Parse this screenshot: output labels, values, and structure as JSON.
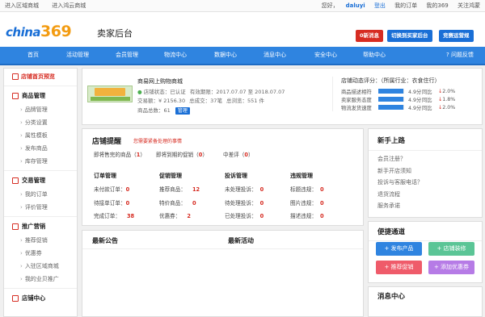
{
  "topbar": {
    "left": [
      "进入区域商城",
      "进入鸿云商城"
    ],
    "greeting": "您好，",
    "username": "daluyi",
    "logout": "登出",
    "right": [
      "我的订单",
      "我的369",
      "关注鸿蒙"
    ]
  },
  "header": {
    "logo_text": "china",
    "logo_number": "369",
    "title": "卖家后台",
    "btn_messages": "0新消息",
    "btn_switch": "切换到买家后台",
    "btn_rules": "竞赛运营规"
  },
  "nav": {
    "items": [
      "首页",
      "活动管理",
      "会员管理",
      "物流中心",
      "数据中心",
      "消息中心",
      "安全中心",
      "帮助中心"
    ],
    "feedback": "问题反馈"
  },
  "sidebar": {
    "home": "店铺首页预览",
    "sections": [
      {
        "title": "商品管理",
        "items": [
          "品牌管理",
          "分类设置",
          "属性模板",
          "发布商品",
          "库存管理"
        ]
      },
      {
        "title": "交易管理",
        "items": [
          "我的订单",
          "评价管理"
        ]
      },
      {
        "title": "推广营销",
        "items": [
          "推荐促销",
          "优惠券",
          "入驻区域商城",
          "我的业贝推广"
        ]
      },
      {
        "title": "店铺中心",
        "items": []
      }
    ]
  },
  "shop": {
    "name": "商易网上购物商城",
    "status_label": "店铺状态：",
    "status_value": "已认证",
    "validity_label": "有效期限：",
    "validity_value": "2017.07.07 至 2018.07.07",
    "trade_label": "交易额：",
    "trade_value": "¥ 2156.30",
    "turnover_label": "总成交：",
    "turnover_value": "37笔",
    "views_label": "总浏览：",
    "views_value": "551 件",
    "goods_label": "商品总数：",
    "goods_value": "61",
    "manage_btn": "管理"
  },
  "rating": {
    "title": "店铺动态评分：（所属行业：衣食住行）",
    "rows": [
      {
        "label": "商品描述相符",
        "score": "4.9分",
        "compare": "同比",
        "arrow": "↓",
        "change": "2.0%",
        "fill": 0.98
      },
      {
        "label": "卖家服务态度",
        "score": "4.9分",
        "compare": "同比",
        "arrow": "↓",
        "change": "1.8%",
        "fill": 0.98
      },
      {
        "label": "物流发货速度",
        "score": "4.9分",
        "compare": "同比",
        "arrow": "↓",
        "change": "2.0%",
        "fill": 0.98
      }
    ]
  },
  "alerts": {
    "title": "店铺提醒",
    "subtitle": "您需要紧备处理的事情",
    "top_items": [
      {
        "label": "即将售完的商品（",
        "count": "1",
        "end": "）"
      },
      {
        "label": "即将到期的促销（",
        "count": "0",
        "end": "）"
      },
      {
        "label": "中差评（",
        "count": "0",
        "end": "）"
      }
    ],
    "columns": [
      {
        "head": "订单管理",
        "rows": [
          [
            "未付款订单：",
            "0"
          ],
          [
            "待接单订单：",
            "0"
          ],
          [
            "完成订单：",
            "38"
          ]
        ]
      },
      {
        "head": "促销管理",
        "rows": [
          [
            "推荐商品：",
            "12"
          ],
          [
            "特价商品：",
            "0"
          ],
          [
            "优惠券：",
            "2"
          ]
        ]
      },
      {
        "head": "投诉管理",
        "rows": [
          [
            "未处理投诉：",
            "0"
          ],
          [
            "待处理投诉：",
            "0"
          ],
          [
            "已处理投诉：",
            "0"
          ]
        ]
      },
      {
        "head": "违规管理",
        "rows": [
          [
            "标题违规：",
            "0"
          ],
          [
            "图片违规：",
            "0"
          ],
          [
            "描述违规：",
            "0"
          ]
        ]
      }
    ]
  },
  "newbie": {
    "title": "新手上路",
    "items": [
      "会员注册？",
      "新手开店须知",
      "投诉与客服电话？",
      "退货流程",
      "服务承诺"
    ]
  },
  "quick": {
    "title": "便捷通道",
    "buttons": [
      "+ 发布产品",
      "+ 店铺装修",
      "+ 推荐促销",
      "+ 添加优惠券"
    ]
  },
  "message": {
    "title": "消息中心"
  },
  "news": {
    "announce": "最新公告",
    "activity": "最新活动"
  }
}
